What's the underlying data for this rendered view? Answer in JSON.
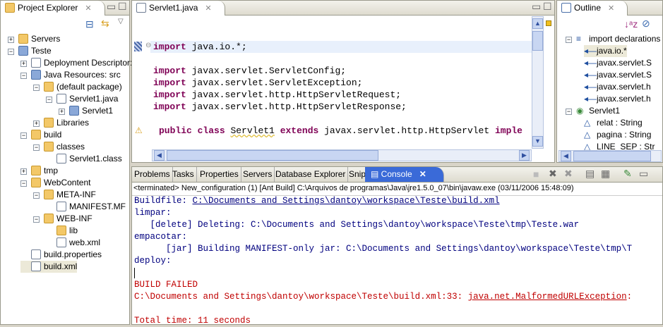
{
  "project_explorer": {
    "title": "Project Explorer",
    "items": [
      {
        "label": "Servers",
        "depth": 0,
        "expander": "+",
        "icon": "folder"
      },
      {
        "label": "Teste",
        "depth": 0,
        "expander": "-",
        "icon": "proj"
      },
      {
        "label": "Deployment Descriptor:",
        "depth": 1,
        "expander": "+",
        "icon": "file"
      },
      {
        "label": "Java Resources: src",
        "depth": 1,
        "expander": "-",
        "icon": "proj"
      },
      {
        "label": "(default package)",
        "depth": 2,
        "expander": "-",
        "icon": "folder"
      },
      {
        "label": "Servlet1.java",
        "depth": 3,
        "expander": "-",
        "icon": "file"
      },
      {
        "label": "Servlet1",
        "depth": 4,
        "expander": "+",
        "icon": "proj"
      },
      {
        "label": "Libraries",
        "depth": 2,
        "expander": "+",
        "icon": "folder"
      },
      {
        "label": "build",
        "depth": 1,
        "expander": "-",
        "icon": "folder"
      },
      {
        "label": "classes",
        "depth": 2,
        "expander": "-",
        "icon": "folder"
      },
      {
        "label": "Servlet1.class",
        "depth": 3,
        "expander": "",
        "icon": "file"
      },
      {
        "label": "tmp",
        "depth": 1,
        "expander": "+",
        "icon": "folder"
      },
      {
        "label": "WebContent",
        "depth": 1,
        "expander": "-",
        "icon": "folder"
      },
      {
        "label": "META-INF",
        "depth": 2,
        "expander": "-",
        "icon": "folder"
      },
      {
        "label": "MANIFEST.MF",
        "depth": 3,
        "expander": "",
        "icon": "file"
      },
      {
        "label": "WEB-INF",
        "depth": 2,
        "expander": "-",
        "icon": "folder"
      },
      {
        "label": "lib",
        "depth": 3,
        "expander": "",
        "icon": "folder"
      },
      {
        "label": "web.xml",
        "depth": 3,
        "expander": "",
        "icon": "file"
      },
      {
        "label": "build.properties",
        "depth": 1,
        "expander": "",
        "icon": "file"
      },
      {
        "label": "build.xml",
        "depth": 1,
        "expander": "",
        "icon": "file",
        "selected": true
      }
    ]
  },
  "editor": {
    "tab": "Servlet1.java",
    "lines": [
      {
        "kw": "import",
        "rest": " java.io.*;"
      },
      {
        "kw": "import",
        "rest": " javax.servlet.ServletConfig;"
      },
      {
        "kw": "import",
        "rest": " javax.servlet.ServletException;"
      },
      {
        "kw": "import",
        "rest": " javax.servlet.http.HttpServletRequest;"
      },
      {
        "kw": "import",
        "rest": " javax.servlet.http.HttpServletResponse;"
      }
    ],
    "class_line": {
      "kw1": "public",
      "kw2": "class",
      "name": "Servlet1",
      "kw3": "extends",
      "sup": "javax.servlet.http.HttpServlet",
      "kw4": "imple"
    }
  },
  "outline": {
    "title": "Outline",
    "items": [
      {
        "label": "import declarations",
        "depth": 0
      },
      {
        "label": "java.io.*",
        "depth": 1
      },
      {
        "label": "javax.servlet.S",
        "depth": 1
      },
      {
        "label": "javax.servlet.S",
        "depth": 1
      },
      {
        "label": "javax.servlet.h",
        "depth": 1
      },
      {
        "label": "javax.servlet.h",
        "depth": 1
      },
      {
        "label": "Servlet1",
        "depth": 0
      },
      {
        "label": "relat : String",
        "depth": 1
      },
      {
        "label": "pagina : String",
        "depth": 1
      },
      {
        "label": "LINE_SEP : Str",
        "depth": 1
      }
    ]
  },
  "bottom": {
    "tabs": [
      "Problems",
      "Tasks",
      "Properties",
      "Servers",
      "Database Explorer",
      "Snippets"
    ],
    "active_tab": "Console",
    "status": "<terminated> New_configuration (1) [Ant Build] C:\\Arquivos de programas\\Java\\jre1.5.0_07\\bin\\javaw.exe (03/11/2006 15:48:09)",
    "console": {
      "l1a": "Buildfile: ",
      "l1b": "C:\\Documents and Settings\\dantoy\\workspace\\Teste\\build.xml",
      "l2": "limpar:",
      "l3": "   [delete] Deleting: C:\\Documents and Settings\\dantoy\\workspace\\Teste\\tmp\\Teste.war",
      "l4": "empacotar:",
      "l5": "      [jar] Building MANIFEST-only jar: C:\\Documents and Settings\\dantoy\\workspace\\Teste\\tmp\\T",
      "l6": "deploy:",
      "l7": "BUILD FAILED",
      "l8a": "C:\\Documents and Settings\\dantoy\\workspace\\Teste\\build.xml:33: ",
      "l8b": "java.net.MalformedURLException",
      ":": ":",
      "l9": "Total time: 11 seconds"
    }
  }
}
